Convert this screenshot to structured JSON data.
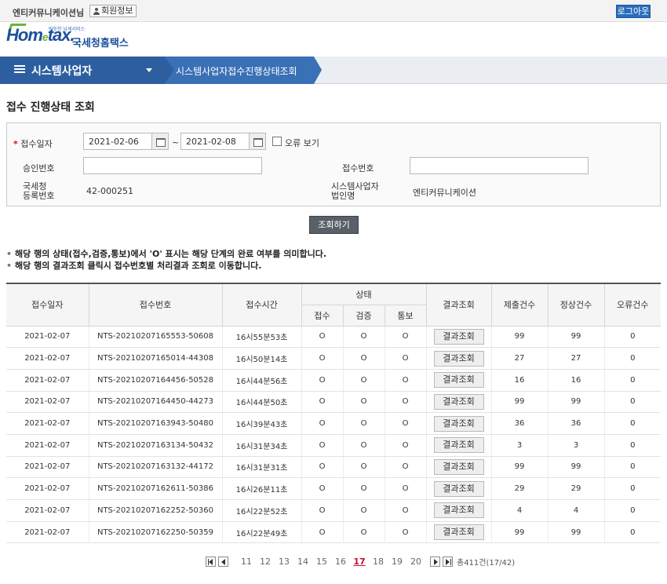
{
  "topbar": {
    "user": "엔티커뮤니케이션님",
    "member_label": "회원정보",
    "logout_label": "로그아웃"
  },
  "logo": {
    "brand_main": "Hom",
    "brand_e": "e",
    "brand_tail": "tax.",
    "tagline": "국세청홈택스",
    "small": "반듯한 납세서비스"
  },
  "nav": {
    "section": "시스템사업자",
    "page": "시스템사업자접수진행상태조회"
  },
  "page_title": "접수 진행상태 조회",
  "search": {
    "date_label": "접수일자",
    "required_mark": "*",
    "date_from": "2021-02-06",
    "date_to": "2021-02-08",
    "tilde": "~",
    "error_view_label": "오류 보기",
    "approval_label": "승인번호",
    "approval_value": "",
    "receipt_label": "접수번호",
    "receipt_value": "",
    "reg_label_1": "국세청",
    "reg_label_2": "등록번호",
    "reg_value": "42-000251",
    "corp_label_1": "시스템사업자",
    "corp_label_2": "법인명",
    "corp_value": "엔티커뮤니케이션"
  },
  "query_button": "조회하기",
  "notes": [
    "해당 행의 상태(접수,검증,통보)에서 'O' 표시는 해당 단계의 완료 여부를 의미합니다.",
    "해당 행의 결과조회 클릭시 접수번호별 처리결과 조회로 이동합니다."
  ],
  "table": {
    "headers": {
      "date": "접수일자",
      "receipt_no": "접수번호",
      "time": "접수시간",
      "status": "상태",
      "received": "접수",
      "verified": "검증",
      "notified": "통보",
      "result": "결과조회",
      "submitted": "제출건수",
      "normal": "정상건수",
      "error": "오류건수"
    },
    "result_button": "결과조회",
    "rows": [
      {
        "date": "2021-02-07",
        "no": "NTS-20210207165553-50608",
        "time": "16시55분53초",
        "s1": "O",
        "s2": "O",
        "s3": "O",
        "submitted": "99",
        "normal": "99",
        "error": "0"
      },
      {
        "date": "2021-02-07",
        "no": "NTS-20210207165014-44308",
        "time": "16시50분14초",
        "s1": "O",
        "s2": "O",
        "s3": "O",
        "submitted": "27",
        "normal": "27",
        "error": "0"
      },
      {
        "date": "2021-02-07",
        "no": "NTS-20210207164456-50528",
        "time": "16시44분56초",
        "s1": "O",
        "s2": "O",
        "s3": "O",
        "submitted": "16",
        "normal": "16",
        "error": "0"
      },
      {
        "date": "2021-02-07",
        "no": "NTS-20210207164450-44273",
        "time": "16시44분50초",
        "s1": "O",
        "s2": "O",
        "s3": "O",
        "submitted": "99",
        "normal": "99",
        "error": "0"
      },
      {
        "date": "2021-02-07",
        "no": "NTS-20210207163943-50480",
        "time": "16시39분43초",
        "s1": "O",
        "s2": "O",
        "s3": "O",
        "submitted": "36",
        "normal": "36",
        "error": "0"
      },
      {
        "date": "2021-02-07",
        "no": "NTS-20210207163134-50432",
        "time": "16시31분34초",
        "s1": "O",
        "s2": "O",
        "s3": "O",
        "submitted": "3",
        "normal": "3",
        "error": "0"
      },
      {
        "date": "2021-02-07",
        "no": "NTS-20210207163132-44172",
        "time": "16시31분31초",
        "s1": "O",
        "s2": "O",
        "s3": "O",
        "submitted": "99",
        "normal": "99",
        "error": "0"
      },
      {
        "date": "2021-02-07",
        "no": "NTS-20210207162611-50386",
        "time": "16시26분11초",
        "s1": "O",
        "s2": "O",
        "s3": "O",
        "submitted": "29",
        "normal": "29",
        "error": "0"
      },
      {
        "date": "2021-02-07",
        "no": "NTS-20210207162252-50360",
        "time": "16시22분52초",
        "s1": "O",
        "s2": "O",
        "s3": "O",
        "submitted": "4",
        "normal": "4",
        "error": "0"
      },
      {
        "date": "2021-02-07",
        "no": "NTS-20210207162250-50359",
        "time": "16시22분49초",
        "s1": "O",
        "s2": "O",
        "s3": "O",
        "submitted": "99",
        "normal": "99",
        "error": "0"
      }
    ]
  },
  "pager": {
    "pages": [
      "11",
      "12",
      "13",
      "14",
      "15",
      "16",
      "17",
      "18",
      "19",
      "20"
    ],
    "current": "17",
    "total": "총411건(17/42)"
  },
  "colors": {
    "brand_blue": "#2d5fa0",
    "logout_blue": "#2a6ebc",
    "current_page_red": "#c8102e"
  }
}
